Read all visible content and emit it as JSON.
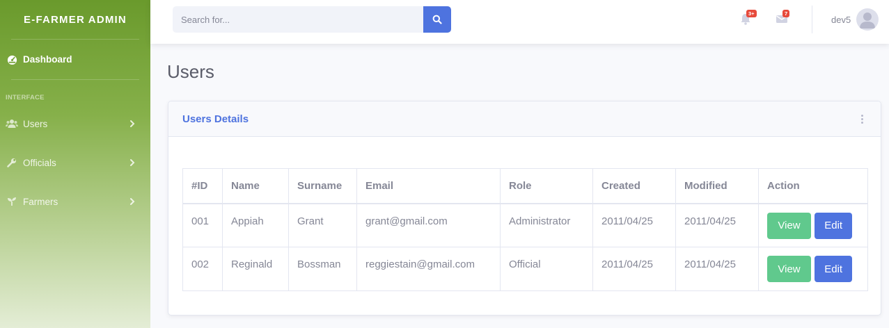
{
  "sidebar": {
    "brand": "E-FARMER ADMIN",
    "dashboard": {
      "label": "Dashboard",
      "icon": "tachometer-icon"
    },
    "heading": "INTERFACE",
    "items": [
      {
        "label": "Users",
        "icon": "users-icon"
      },
      {
        "label": "Officials",
        "icon": "wrench-icon"
      },
      {
        "label": "Farmers",
        "icon": "seedling-icon"
      }
    ]
  },
  "topbar": {
    "search_placeholder": "Search for...",
    "alerts_badge": "3+",
    "messages_badge": "7",
    "username": "dev5"
  },
  "page": {
    "title": "Users",
    "card_title": "Users Details"
  },
  "table": {
    "headers": [
      "#ID",
      "Name",
      "Surname",
      "Email",
      "Role",
      "Created",
      "Modified",
      "Action"
    ],
    "rows": [
      {
        "id": "001",
        "name": "Appiah",
        "surname": "Grant",
        "email": "grant@gmail.com",
        "role": "Administrator",
        "created": "2011/04/25",
        "modified": "2011/04/25",
        "view": "View",
        "edit": "Edit"
      },
      {
        "id": "002",
        "name": "Reginald",
        "surname": "Bossman",
        "email": "reggiestain@gmail.com",
        "role": "Official",
        "created": "2011/04/25",
        "modified": "2011/04/25",
        "view": "View",
        "edit": "Edit"
      }
    ]
  },
  "colors": {
    "primary": "#4e73df",
    "success": "#60c98d",
    "danger": "#e74a3b",
    "sidebar": "#6a9a2c"
  }
}
